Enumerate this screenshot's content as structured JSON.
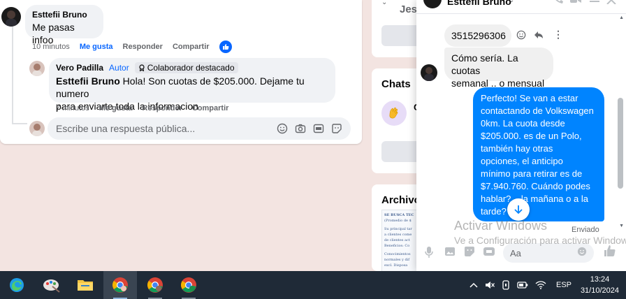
{
  "comment1": {
    "author": "Esttefii Bruno",
    "text": "Me pasas infoo",
    "time": "10 minutos",
    "like": "Me gusta",
    "reply": "Responder",
    "share": "Compartir"
  },
  "reply1": {
    "author": "Vero Padilla",
    "role": "Autor",
    "badge": "Colaborador destacado",
    "mention": "Esttefii Bruno",
    "text_line1": "Hola! Son cuotas de $205.000. Dejame tu numero",
    "text_line2": "para enviarte toda la informacion",
    "time": "7 minutos",
    "like": "Me gusta",
    "reply": "Responder",
    "share": "Compartir"
  },
  "reply_box": {
    "placeholder": "Escribe una respuesta pública..."
  },
  "right_column": {
    "card_top_partial": "Jesu",
    "chats_title": "Chats",
    "chat_item_partial": "C",
    "archive_title": "Archivo",
    "doc_lines": [
      "SE BUSCA TEC",
      "(Promedio de $",
      "Su principal tar",
      "a clientes come",
      "de clientes act",
      "Beneficios: Co",
      "Conocimientos",
      "normales y dif",
      "excl. Disposa"
    ]
  },
  "chat": {
    "contact": "Esttefii Bruno",
    "messages": [
      {
        "from": "contact",
        "text": "3515296306"
      },
      {
        "from": "contact",
        "lines": [
          "Cómo sería. La cuotas",
          "semanal .. o mensual"
        ]
      },
      {
        "from": "me",
        "lines": [
          "Perfecto!  Se van a estar",
          "contactando de Volkswagen",
          "0km. La cuota desde",
          "$205.000. es de un Polo,",
          "también hay otras",
          "opciones, el anticipo",
          "mínimo para retirar es de",
          "$7.940.760. Cuándo podes",
          "hablar? ...la mañana o a la",
          "tarde?"
        ]
      }
    ],
    "status": "Enviado",
    "composer_placeholder": "Aa"
  },
  "watermark": {
    "line1": "Activar Windows",
    "line2": "Ve a Configuración para activar Windows."
  },
  "taskbar": {
    "language": "ESP",
    "time": "13:24",
    "date": "31/10/2024"
  },
  "colors": {
    "accent": "#0866ff",
    "messenger_blue": "#0084ff",
    "taskbar": "#1f2a37",
    "page_bg": "#f3e4e1"
  }
}
